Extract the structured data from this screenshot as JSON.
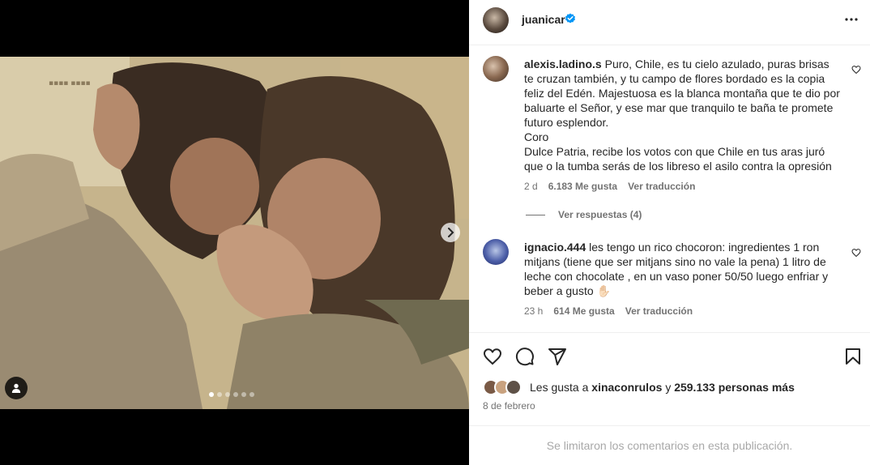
{
  "post": {
    "author": "juanicar",
    "more_icon": "more-horizontal-icon",
    "carousel": {
      "slide_count": 6,
      "active_slide": 1
    }
  },
  "comments": [
    {
      "user": "alexis.ladino.s",
      "text": "Puro, Chile, es tu cielo azulado, puras brisas te cruzan también, y tu campo de flores bordado es la copia feliz del Edén. Majestuosa es la blanca montaña que te dio por baluarte el Señor, y ese mar que tranquilo te baña te promete futuro esplendor.\nCoro\nDulce Patria, recibe los votos con que Chile en tus aras juró que o la tumba serás de los libreso el asilo contra la opresión",
      "age": "2 d",
      "likes": "6.183 Me gusta",
      "translate": "Ver traducción",
      "replies": "Ver respuestas (4)"
    },
    {
      "user": "ignacio.444",
      "text": "les tengo un rico chocoron: ingredientes 1 ron mitjans (tiene que ser mitjans sino no vale la pena) 1 litro de leche con chocolate , en un vaso poner 50/50 luego enfriar y beber a gusto ✋🏻",
      "age": "23 h",
      "likes": "614 Me gusta",
      "translate": "Ver traducción"
    }
  ],
  "likes_summary": {
    "prefix": "Les gusta a",
    "user": "xinaconrulos",
    "joiner": "y",
    "others": "259.133 personas más"
  },
  "date": "8 de febrero",
  "footer_notice": "Se limitaron los comentarios en esta publicación.",
  "colors": {
    "verified": "#0095f6",
    "meta_text": "#737373",
    "border": "#efefef"
  }
}
